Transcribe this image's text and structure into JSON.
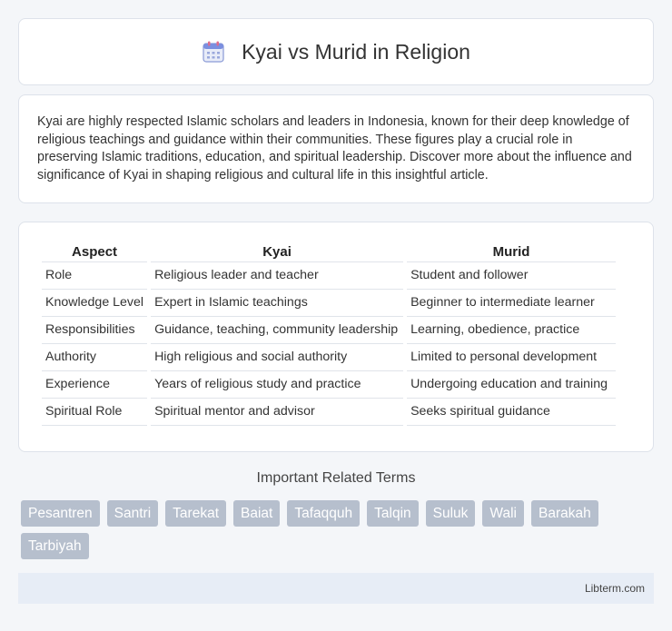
{
  "header": {
    "title": "Kyai vs Murid in Religion",
    "icon": "calendar-icon"
  },
  "intro": {
    "text": "Kyai are highly respected Islamic scholars and leaders in Indonesia, known for their deep knowledge of religious teachings and guidance within their communities. These figures play a crucial role in preserving Islamic traditions, education, and spiritual leadership. Discover more about the influence and significance of Kyai in shaping religious and cultural life in this insightful article."
  },
  "table": {
    "headers": [
      "Aspect",
      "Kyai",
      "Murid"
    ],
    "rows": [
      [
        "Role",
        "Religious leader and teacher",
        "Student and follower"
      ],
      [
        "Knowledge Level",
        "Expert in Islamic teachings",
        "Beginner to intermediate learner"
      ],
      [
        "Responsibilities",
        "Guidance, teaching, community leadership",
        "Learning, obedience, practice"
      ],
      [
        "Authority",
        "High religious and social authority",
        "Limited to personal development"
      ],
      [
        "Experience",
        "Years of religious study and practice",
        "Undergoing education and training"
      ],
      [
        "Spiritual Role",
        "Spiritual mentor and advisor",
        "Seeks spiritual guidance"
      ]
    ]
  },
  "terms": {
    "title": "Important Related Terms",
    "items": [
      "Pesantren",
      "Santri",
      "Tarekat",
      "Baiat",
      "Tafaqquh",
      "Talqin",
      "Suluk",
      "Wali",
      "Barakah",
      "Tarbiyah"
    ]
  },
  "footer": {
    "text": "Libterm.com"
  },
  "colors": {
    "tag_bg": "#b6bfcd",
    "footer_bg": "#e7edf6",
    "page_bg": "#f4f6f9"
  }
}
